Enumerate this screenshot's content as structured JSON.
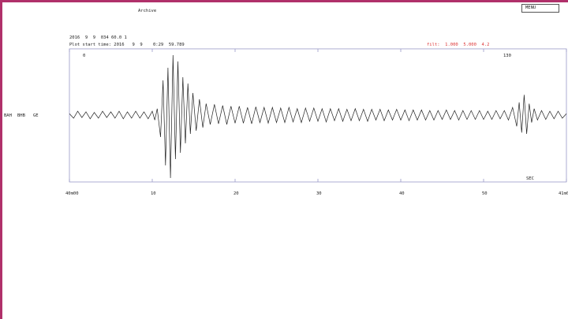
{
  "window": {
    "title": "Archive",
    "menu_button": "MENU"
  },
  "header": {
    "origin_line": "2016  9  9  034 60.0 1",
    "plot_start": "Plot start time: 2016   9  9    0:29  59.789",
    "filter": "filt:  1.000  5.000  4.2"
  },
  "station": {
    "code": "BAH",
    "component": "BHB",
    "network": "GE"
  },
  "markers": {
    "left": "0",
    "right": "130"
  },
  "colors": {
    "trace": "#222222",
    "frame": "#9a9ac8",
    "filter_text": "#dd3333",
    "accent": "#b0306a"
  },
  "chart_data": {
    "type": "line",
    "xlabel": "SEC",
    "x_ticks": [
      "40m00",
      "10",
      "20",
      "30",
      "40",
      "50",
      "41m00"
    ],
    "x_range": [
      0,
      60
    ],
    "y_range": [
      -1,
      1
    ],
    "series": [
      {
        "values": [
          [
            0,
            0.02
          ],
          [
            0.5,
            -0.05
          ],
          [
            1,
            0.06
          ],
          [
            1.5,
            -0.04
          ],
          [
            2,
            0.05
          ],
          [
            2.5,
            -0.06
          ],
          [
            3,
            0.04
          ],
          [
            3.5,
            -0.05
          ],
          [
            4,
            0.06
          ],
          [
            4.5,
            -0.04
          ],
          [
            5,
            0.05
          ],
          [
            5.5,
            -0.05
          ],
          [
            6,
            0.06
          ],
          [
            6.5,
            -0.06
          ],
          [
            7,
            0.05
          ],
          [
            7.5,
            -0.05
          ],
          [
            8,
            0.06
          ],
          [
            8.5,
            -0.05
          ],
          [
            9,
            0.05
          ],
          [
            9.5,
            -0.06
          ],
          [
            10,
            0.06
          ],
          [
            10.3,
            -0.08
          ],
          [
            10.6,
            0.1
          ],
          [
            11,
            -0.35
          ],
          [
            11.3,
            0.55
          ],
          [
            11.6,
            -0.8
          ],
          [
            11.9,
            0.75
          ],
          [
            12.2,
            -1.0
          ],
          [
            12.5,
            0.95
          ],
          [
            12.8,
            -0.7
          ],
          [
            13.1,
            0.85
          ],
          [
            13.4,
            -0.6
          ],
          [
            13.7,
            0.6
          ],
          [
            14,
            -0.45
          ],
          [
            14.3,
            0.5
          ],
          [
            14.6,
            -0.3
          ],
          [
            14.9,
            0.35
          ],
          [
            15.3,
            -0.25
          ],
          [
            15.7,
            0.25
          ],
          [
            16.1,
            -0.2
          ],
          [
            16.5,
            0.18
          ],
          [
            17,
            -0.15
          ],
          [
            17.5,
            0.17
          ],
          [
            18,
            -0.14
          ],
          [
            18.5,
            0.15
          ],
          [
            19,
            -0.15
          ],
          [
            19.5,
            0.14
          ],
          [
            20,
            -0.13
          ],
          [
            20.5,
            0.14
          ],
          [
            21,
            -0.13
          ],
          [
            21.5,
            0.12
          ],
          [
            22,
            -0.14
          ],
          [
            22.5,
            0.13
          ],
          [
            23,
            -0.12
          ],
          [
            23.5,
            0.12
          ],
          [
            24,
            -0.13
          ],
          [
            24.5,
            0.12
          ],
          [
            25,
            -0.12
          ],
          [
            25.5,
            0.11
          ],
          [
            26,
            -0.12
          ],
          [
            26.5,
            0.12
          ],
          [
            27,
            -0.11
          ],
          [
            27.5,
            0.1
          ],
          [
            28,
            -0.12
          ],
          [
            28.5,
            0.11
          ],
          [
            29,
            -0.1
          ],
          [
            29.5,
            0.11
          ],
          [
            30,
            -0.1
          ],
          [
            30.5,
            0.1
          ],
          [
            31,
            -0.11
          ],
          [
            31.5,
            0.1
          ],
          [
            32,
            -0.09
          ],
          [
            32.5,
            0.1
          ],
          [
            33,
            -0.1
          ],
          [
            33.5,
            0.09
          ],
          [
            34,
            -0.09
          ],
          [
            34.5,
            0.1
          ],
          [
            35,
            -0.09
          ],
          [
            35.5,
            0.09
          ],
          [
            36,
            -0.1
          ],
          [
            36.5,
            0.09
          ],
          [
            37,
            -0.08
          ],
          [
            37.5,
            0.09
          ],
          [
            38,
            -0.09
          ],
          [
            38.5,
            0.08
          ],
          [
            39,
            -0.08
          ],
          [
            39.5,
            0.09
          ],
          [
            40,
            -0.08
          ],
          [
            40.5,
            0.08
          ],
          [
            41,
            -0.09
          ],
          [
            41.5,
            0.08
          ],
          [
            42,
            -0.08
          ],
          [
            42.5,
            0.08
          ],
          [
            43,
            -0.08
          ],
          [
            43.5,
            0.07
          ],
          [
            44,
            -0.08
          ],
          [
            44.5,
            0.07
          ],
          [
            45,
            -0.07
          ],
          [
            45.5,
            0.08
          ],
          [
            46,
            -0.07
          ],
          [
            46.5,
            0.07
          ],
          [
            47,
            -0.08
          ],
          [
            47.5,
            0.07
          ],
          [
            48,
            -0.07
          ],
          [
            48.5,
            0.07
          ],
          [
            49,
            -0.07
          ],
          [
            49.5,
            0.07
          ],
          [
            50,
            -0.07
          ],
          [
            50.5,
            0.06
          ],
          [
            51,
            -0.07
          ],
          [
            51.5,
            0.07
          ],
          [
            52,
            -0.06
          ],
          [
            52.5,
            0.07
          ],
          [
            53,
            -0.08
          ],
          [
            53.5,
            0.12
          ],
          [
            54,
            -0.18
          ],
          [
            54.3,
            0.2
          ],
          [
            54.6,
            -0.28
          ],
          [
            54.9,
            0.32
          ],
          [
            55.2,
            -0.3
          ],
          [
            55.5,
            0.18
          ],
          [
            55.8,
            -0.12
          ],
          [
            56.1,
            0.1
          ],
          [
            56.5,
            -0.08
          ],
          [
            57,
            0.07
          ],
          [
            57.5,
            -0.07
          ],
          [
            58,
            0.06
          ],
          [
            58.5,
            -0.06
          ],
          [
            59,
            0.06
          ],
          [
            59.5,
            -0.05
          ],
          [
            60,
            0.02
          ]
        ]
      }
    ]
  }
}
